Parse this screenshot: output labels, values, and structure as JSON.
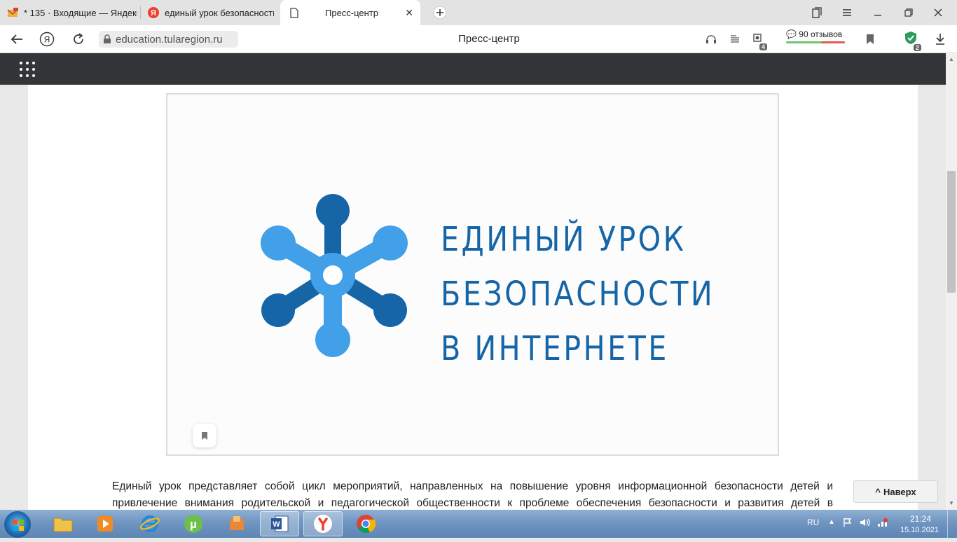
{
  "browser": {
    "tabs": [
      {
        "title": "* 135 · Входящие — Яндекс",
        "icon": "mail-icon"
      },
      {
        "title": "единый урок безопасности",
        "icon": "yandex-icon"
      },
      {
        "title": "Пресс-центр",
        "icon": "page-icon",
        "active": true
      }
    ],
    "url": "education.tularegion.ru",
    "page_title": "Пресс-центр",
    "reviews": "90 отзывов",
    "extension_badge": "4",
    "protect_badge": "2"
  },
  "article": {
    "logo_lines": [
      "ЕДИНЫЙ УРОК",
      "БЕЗОПАСНОСТИ",
      "В ИНТЕРНЕТЕ"
    ],
    "body_lines": [
      "Единый урок представляет собой цикл мероприятий, направленных на повышение уровня информационной безопасности детей и",
      "привлечение внимания родительской и педагогической общественности к проблеме обеспечения безопасности и развития детей в"
    ],
    "up_button": "Наверх"
  },
  "taskbar": {
    "lang": "RU",
    "time": "21:24",
    "date": "15.10.2021"
  },
  "colors": {
    "logo_dark_blue": "#1565a7",
    "logo_light_blue": "#42a0e8",
    "header_bg": "#333638"
  }
}
